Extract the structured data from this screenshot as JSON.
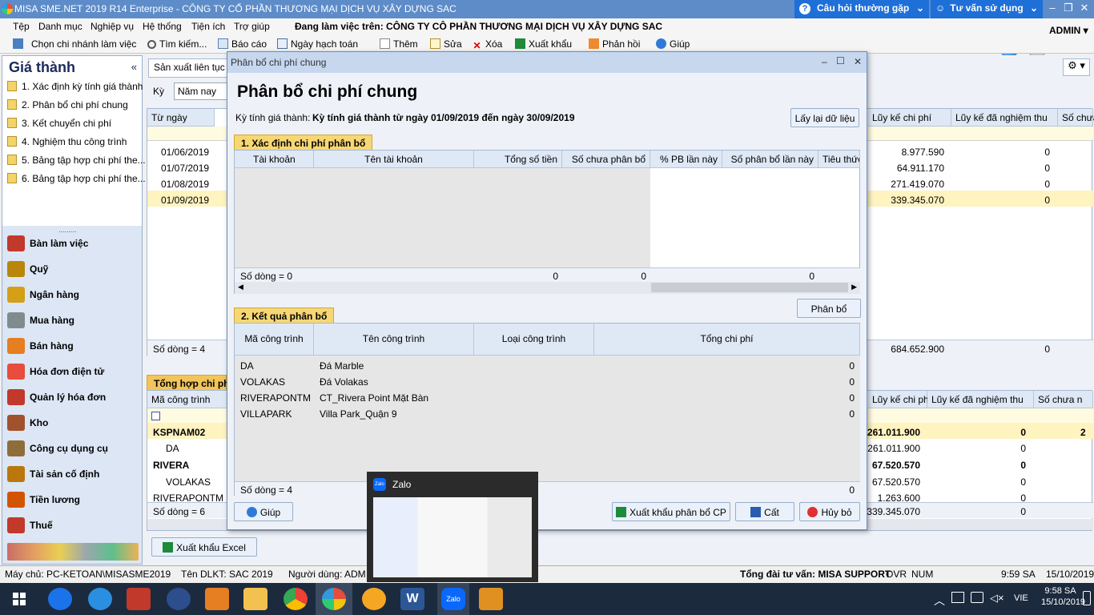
{
  "app": {
    "title": "MISA SME.NET 2019 R14 Enterprise - CÔNG TY CỔ PHẦN THƯƠNG MẠI DỊCH VỤ XÂY DỰNG SAC",
    "faq": "Câu hỏi thường gặp",
    "advice": "Tư vấn sử dụng",
    "user": "ADMIN"
  },
  "menu": {
    "items": [
      "Tệp",
      "Danh mục",
      "Nghiệp vụ",
      "Hệ thống",
      "Tiện ích",
      "Trợ giúp"
    ],
    "working_label": "Đang làm việc trên:",
    "company": "CÔNG TY CÔ PHẦN THƯƠNG MẠI DỊCH VỤ XÂY DỰNG SAC"
  },
  "toolbar": {
    "branch": "Chọn chi nhánh làm việc",
    "search": "Tìm kiếm...",
    "report": "Báo cáo",
    "post_date": "Ngày hạch toán",
    "add": "Thêm",
    "edit": "Sửa",
    "delete": "Xóa",
    "export": "Xuất khẩu",
    "feedback": "Phản hồi",
    "help": "Giúp"
  },
  "left": {
    "title": "Giá thành",
    "collapse": "«",
    "steps": [
      "1. Xác định kỳ tính giá thành",
      "2. Phân bổ chi phí chung",
      "3. Kết chuyển chi phí",
      "4. Nghiệm thu công trình",
      "5. Bảng tập hợp chi phí the...",
      "6. Bảng tập hợp chi phí the..."
    ],
    "modules": [
      "Bàn làm việc",
      "Quỹ",
      "Ngân hàng",
      "Mua hàng",
      "Bán hàng",
      "Hóa đơn điện tử",
      "Quản lý hóa đơn",
      "Kho",
      "Công cụ dụng cụ",
      "Tài sản cố định",
      "Tiền lương",
      "Thuế"
    ]
  },
  "main": {
    "tab": "Sản xuất liên tục -",
    "period_label": "Kỳ",
    "period_value": "Năm nay",
    "top_headers": [
      "Từ ngày",
      "Lũy kế chi phí",
      "Lũy kế đã nghiệm thu",
      "Số chưa"
    ],
    "top_rows": [
      {
        "d": "01/06/2019",
        "a": "8.977.590",
        "b": "0"
      },
      {
        "d": "01/07/2019",
        "a": "64.911.170",
        "b": "0"
      },
      {
        "d": "01/08/2019",
        "a": "271.419.070",
        "b": "0"
      },
      {
        "d": "01/09/2019",
        "a": "339.345.070",
        "b": "0"
      }
    ],
    "top_count": "Số dòng = 4",
    "top_total": "684.652.900",
    "top_total_b": "0",
    "summary_tab": "Tổng hợp chi phí",
    "bottom_headers": [
      "Mã công trình",
      "Lũy kế chi phí",
      "Lũy kế đã nghiệm thu",
      "Số chưa n"
    ],
    "bottom_rows": [
      {
        "c": "KSPNAM02",
        "a": "261.011.900",
        "b": "0",
        "x": "2",
        "bold": true
      },
      {
        "c": "DA",
        "a": "261.011.900",
        "b": "0",
        "x": "",
        "bold": false
      },
      {
        "c": "RIVERA",
        "a": "67.520.570",
        "b": "0",
        "x": "",
        "bold": true
      },
      {
        "c": "VOLAKAS",
        "a": "67.520.570",
        "b": "0",
        "x": "",
        "bold": false
      },
      {
        "c": "RIVERAPONTM",
        "a": "1.263.600",
        "b": "0",
        "x": "",
        "bold": false
      }
    ],
    "bottom_count": "Số dòng = 6",
    "bottom_total": "339.345.070",
    "bottom_total_b": "0",
    "export_excel": "Xuất khẩu Excel"
  },
  "dialog": {
    "window_title": "Phân bổ chi phí chung",
    "heading": "Phân bổ chi phí chung",
    "period_label": "Kỳ tính giá thành:",
    "period_value": "Kỳ tính giá thành từ ngày 01/09/2019 đến ngày 30/09/2019",
    "reload": "Lấy lại dữ liệu",
    "sec1": "1. Xác định chi phí phân bổ",
    "g1_headers": [
      "Tài khoản",
      "Tên tài khoản",
      "Tổng số tiền",
      "Số chưa phân bổ",
      "% PB lần này",
      "Số phân bổ lần này",
      "Tiêu thức"
    ],
    "g1_count": "Số dòng = 0",
    "g1_sum": [
      "0",
      "0",
      "0"
    ],
    "allocate": "Phân bổ",
    "sec2": "2. Kết quả phân bổ",
    "g2_headers": [
      "Mã công trình",
      "Tên công trình",
      "Loại công trình",
      "Tổng chi phí"
    ],
    "g2_rows": [
      {
        "c": "DA",
        "n": "Đá Marble",
        "v": "0"
      },
      {
        "c": "VOLAKAS",
        "n": "Đá Volakas",
        "v": "0"
      },
      {
        "c": "RIVERAPONTM",
        "n": "CT_Rivera Point Mặt Bàn",
        "v": "0"
      },
      {
        "c": "VILLAPARK",
        "n": "Villa Park_Quận 9",
        "v": "0"
      }
    ],
    "g2_count": "Số dòng = 4",
    "g2_sum": "0",
    "help": "Giúp",
    "export": "Xuất khẩu phân bổ CP",
    "save": "Cất",
    "cancel": "Hủy bỏ"
  },
  "status": {
    "server": "Máy chủ: PC-KETOAN\\MISASME2019",
    "db": "Tên DLKT: SAC 2019",
    "user": "Người dùng: ADM",
    "hotline": "Tổng đài tư vấn: MISA SUPPORT",
    "ovr": "OVR",
    "num": "NUM",
    "time": "9:59 SA",
    "date": "15/10/2019"
  },
  "zalo": {
    "title": "Zalo",
    "icon": "Zalo"
  },
  "taskbar": {
    "time": "9:58 SA",
    "date": "15/10/2019",
    "lang": "VIE",
    "zalo_icon": "Zalo",
    "word_icon": "W"
  },
  "colors": {
    "titlebar": "#5d8cc9",
    "help_blue": "#1e6fd8",
    "section": "#f7d774",
    "taskbar": "#1c2a3e"
  }
}
